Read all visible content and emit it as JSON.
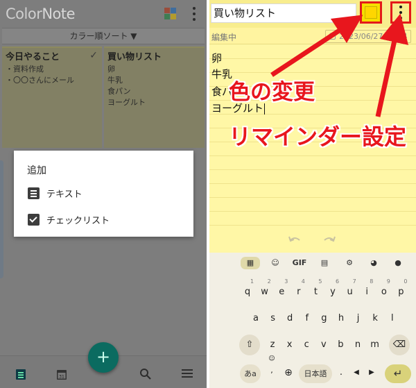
{
  "left": {
    "app_name_color": "Color",
    "app_name_note": "Note",
    "sort_label": "カラー順ソート ▼",
    "notes": [
      {
        "title": "今日やること",
        "lines": [
          "・資料作成",
          "・〇〇さんにメール"
        ],
        "checked": true
      },
      {
        "title": "買い物リスト",
        "lines": [
          "卵",
          "牛乳",
          "食パン",
          "ヨーグルト"
        ]
      }
    ],
    "add_dialog": {
      "title": "追加",
      "options": [
        {
          "label": "テキスト",
          "icon": "lines-icon"
        },
        {
          "label": "チェックリスト",
          "icon": "checkbox-icon"
        }
      ]
    },
    "fab_label": "+",
    "nav": [
      "notes-icon",
      "calendar-icon",
      "search-icon",
      "menu-icon"
    ],
    "calendar_day": "31"
  },
  "right": {
    "title_value": "買い物リスト",
    "status": "編集中",
    "reminder_date": "2023/06/27 14:04",
    "body_lines": [
      "卵",
      "牛乳",
      "食パン",
      "ヨーグルト"
    ],
    "keyboard": {
      "toolbar": [
        "grid-icon",
        "sticker-icon",
        "GIF",
        "clipboard-icon",
        "gear-icon",
        "palette-icon",
        "mic-icon"
      ],
      "gif_label": "GIF",
      "row1": [
        "q",
        "w",
        "e",
        "r",
        "t",
        "y",
        "u",
        "i",
        "o",
        "p"
      ],
      "row1_nums": [
        "1",
        "2",
        "3",
        "4",
        "5",
        "6",
        "7",
        "8",
        "9",
        "0"
      ],
      "row2": [
        "a",
        "s",
        "d",
        "f",
        "g",
        "h",
        "j",
        "k",
        "l"
      ],
      "row3": [
        "z",
        "x",
        "c",
        "v",
        "b",
        "n",
        "m"
      ],
      "lang_key": "あa",
      "lang_key_sub": "",
      "space_label": "日本語",
      "left_arrow": "◀",
      "right_arrow": "▶",
      "comma": ",",
      "period": ".",
      "emoji": "☺"
    }
  },
  "annotations": {
    "color_change": "色の変更",
    "reminder_setting": "リマインダー設定"
  },
  "colors": {
    "accent_red": "#e8161d",
    "note_yellow": "#fff7a6",
    "fab_teal": "#0b6b60"
  }
}
